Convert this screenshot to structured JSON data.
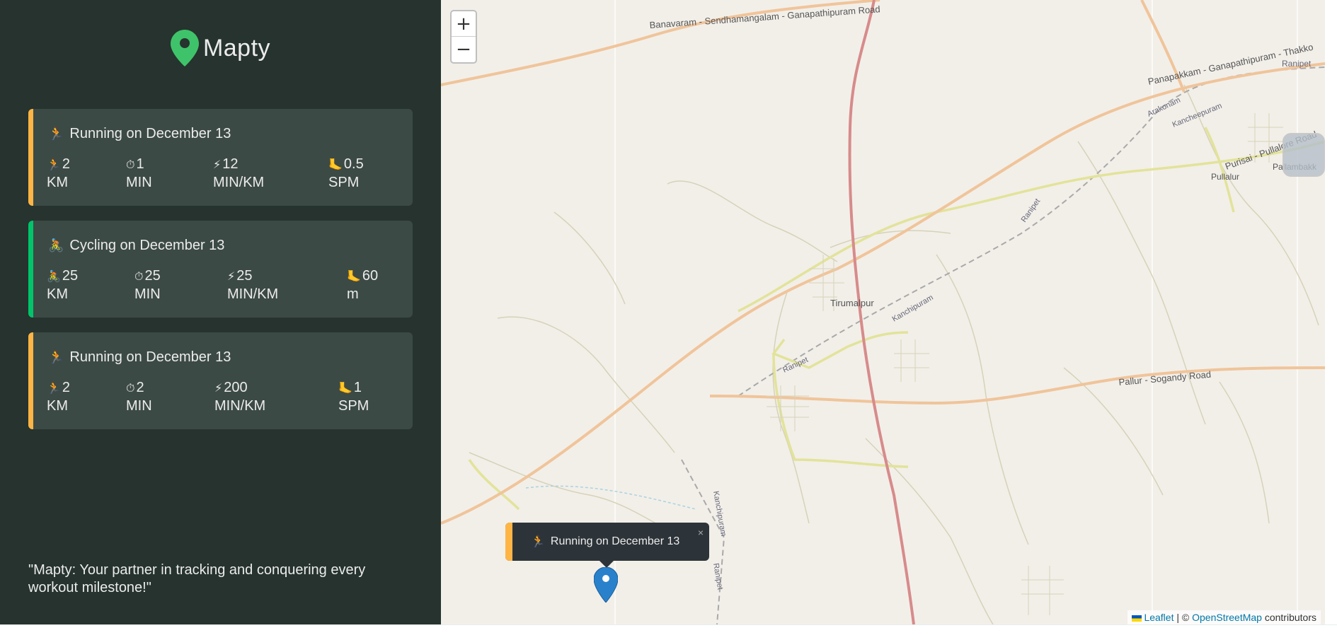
{
  "app": {
    "logo_text": "Mapty"
  },
  "workouts": [
    {
      "type": "running",
      "icon": "🏃",
      "title": "Running on December 13",
      "details": [
        {
          "icon": "🏃",
          "value": "2",
          "unit": "KM"
        },
        {
          "icon": "⏱",
          "value": "1",
          "unit": "MIN"
        },
        {
          "icon": "⚡",
          "value": "12",
          "unit": "MIN/KM"
        },
        {
          "icon": "🦶",
          "value": "0.5",
          "unit": "SPM"
        }
      ]
    },
    {
      "type": "cycling",
      "icon": "🚴",
      "title": "Cycling on December 13",
      "details": [
        {
          "icon": "🚴",
          "value": "25",
          "unit": "KM"
        },
        {
          "icon": "⏱",
          "value": "25",
          "unit": "MIN"
        },
        {
          "icon": "⚡",
          "value": "25",
          "unit": "MIN/KM"
        },
        {
          "icon": "🦶",
          "value": "60",
          "unit": "m"
        }
      ]
    },
    {
      "type": "running",
      "icon": "🏃",
      "title": "Running on December 13",
      "details": [
        {
          "icon": "🏃",
          "value": "2",
          "unit": "KM"
        },
        {
          "icon": "⏱",
          "value": "2",
          "unit": "MIN"
        },
        {
          "icon": "⚡",
          "value": "200",
          "unit": "MIN/KM"
        },
        {
          "icon": "🦶",
          "value": "1",
          "unit": "SPM"
        }
      ]
    }
  ],
  "quote": "\"Mapty: Your partner in tracking and conquering every workout milestone!\"",
  "map": {
    "zoom_in": "+",
    "zoom_out": "−",
    "popup": {
      "icon": "🏃",
      "text": "Running on December 13",
      "close": "×"
    },
    "attribution": {
      "leaflet": "Leaflet",
      "separator": " | © ",
      "osm": "OpenStreetMap",
      "suffix": " contributors"
    },
    "labels": {
      "l1": "Banavaram - Sendhamangalam - Ganapathipuram Road",
      "l2": "Panapakkam - Ganapathipuram - Thakko",
      "l3": "Ranipet",
      "l4": "Arakonam",
      "l5": "Kancheepuram",
      "l6": "Purisai - Pullalore Road",
      "l7": "Pullalur",
      "l8": "Pallambakk",
      "l9": "Ranipet",
      "l10": "Tirumalpur",
      "l11": "Kanchipuram",
      "l12": "Ranipet",
      "l13": "Pallur - Sogandy Road",
      "l14": "Kanchipuram",
      "l15": "Ranipet"
    }
  }
}
